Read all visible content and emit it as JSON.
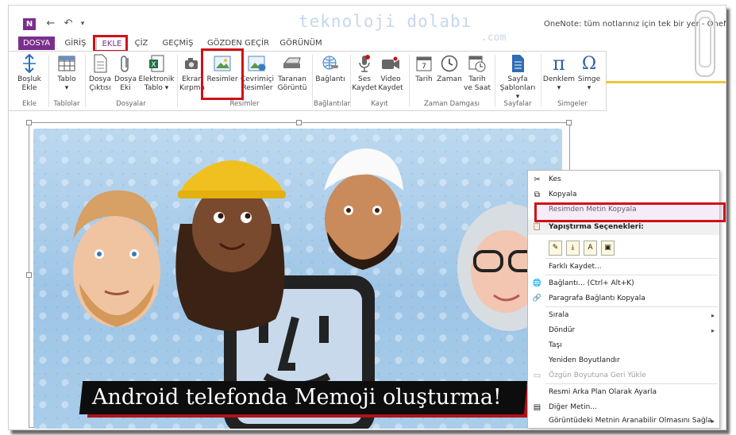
{
  "app": {
    "logo_letter": "N",
    "title": "OneNote: tüm notlarınız için tek bir yer - OneNote",
    "quick_access": {
      "back": "←",
      "undo": "↶",
      "more": "▾"
    }
  },
  "watermark": {
    "main": "teknoloji dolabı",
    "sub": ".com"
  },
  "tabs": [
    {
      "label": "DOSYA"
    },
    {
      "label": "GİRİŞ"
    },
    {
      "label": "EKLE"
    },
    {
      "label": "ÇİZ"
    },
    {
      "label": "GEÇMİŞ"
    },
    {
      "label": "GÖZDEN GEÇİR"
    },
    {
      "label": "GÖRÜNÜM"
    }
  ],
  "ribbon": {
    "buttons": [
      {
        "label": "Boşluk\nEkle",
        "icon": "insert-space-icon"
      },
      {
        "label": "Tablo\n▾",
        "icon": "table-icon"
      },
      {
        "label": "Dosya\nÇıktısı",
        "icon": "file-printout-icon"
      },
      {
        "label": "Dosya\nEki",
        "icon": "attachment-icon"
      },
      {
        "label": "Elektronik\nTablo ▾",
        "icon": "spreadsheet-icon"
      },
      {
        "label": "Ekran\nKırpma",
        "icon": "screen-clipping-icon"
      },
      {
        "label": "Resimler",
        "icon": "pictures-icon"
      },
      {
        "label": "Çevrimiçi\nResimler",
        "icon": "online-pictures-icon"
      },
      {
        "label": "Taranan\nGörüntü",
        "icon": "scanner-icon"
      },
      {
        "label": "Bağlantı",
        "icon": "link-icon"
      },
      {
        "label": "Ses\nKaydet",
        "icon": "microphone-icon"
      },
      {
        "label": "Video\nKaydet",
        "icon": "video-camera-icon"
      },
      {
        "label": "Tarih",
        "icon": "calendar-icon"
      },
      {
        "label": "Zaman",
        "icon": "clock-icon"
      },
      {
        "label": "Tarih\nve Saat",
        "icon": "calendar-clock-icon"
      },
      {
        "label": "Sayfa\nŞablonları ▾",
        "icon": "page-template-icon"
      },
      {
        "label": "Denklem\n▾",
        "icon": "pi-icon",
        "glyph": "π"
      },
      {
        "label": "Simge\n▾",
        "icon": "omega-icon",
        "glyph": "Ω"
      }
    ],
    "groups": [
      "Ekle",
      "Tablolar",
      "Dosyalar",
      "Resimler",
      "Bağlantılar",
      "Kayıt",
      "Zaman Damgası",
      "Sayfalar",
      "Simgeler"
    ]
  },
  "image": {
    "caption": "Android telefonda Memoji oluşturma!"
  },
  "context_menu": {
    "items": [
      {
        "label": "Kes",
        "icon": "scissors-icon",
        "glyph": "✂"
      },
      {
        "label": "Kopyala",
        "icon": "copy-icon",
        "glyph": "⧉"
      },
      {
        "label": "Resimden Metin Kopyala",
        "icon": "",
        "glyph": ""
      },
      {
        "label": "Yapıştırma Seçenekleri:",
        "icon": "paste-icon",
        "glyph": "📋"
      },
      {
        "label": "Farklı Kaydet...",
        "icon": "",
        "glyph": ""
      },
      {
        "label": "Bağlantı...  (Ctrl+ Alt+K)",
        "icon": "link-icon",
        "glyph": "🌐"
      },
      {
        "label": "Paragrafa Bağlantı Kopyala",
        "icon": "paragraph-link-icon",
        "glyph": "🔗"
      },
      {
        "label": "Sırala",
        "icon": "",
        "glyph": "",
        "arrow": "▸"
      },
      {
        "label": "Döndür",
        "icon": "",
        "glyph": "",
        "arrow": "▸"
      },
      {
        "label": "Taşı",
        "icon": "",
        "glyph": ""
      },
      {
        "label": "Yeniden Boyutlandır",
        "icon": "",
        "glyph": ""
      },
      {
        "label": "Özgün Boyutuna Geri Yükle",
        "icon": "restore-size-icon",
        "glyph": "▭"
      },
      {
        "label": "Resmi Arka Plan Olarak Ayarla",
        "icon": "",
        "glyph": ""
      },
      {
        "label": "Diğer Metin...",
        "icon": "alt-text-icon",
        "glyph": "▤"
      },
      {
        "label": "Görüntüdeki Metnin Aranabilir Olmasını Sağla",
        "icon": "",
        "glyph": "",
        "arrow": "▸"
      }
    ],
    "paste_options": [
      {
        "icon": "paste-keep-format-icon",
        "glyph": "✎"
      },
      {
        "icon": "paste-merge-icon",
        "glyph": "⤓"
      },
      {
        "icon": "paste-text-only-icon",
        "glyph": "A"
      },
      {
        "icon": "paste-picture-icon",
        "glyph": "▣"
      }
    ]
  },
  "colors": {
    "brand": "#7b2f8c",
    "highlight": "#d01018",
    "accent": "#f0c33c"
  }
}
